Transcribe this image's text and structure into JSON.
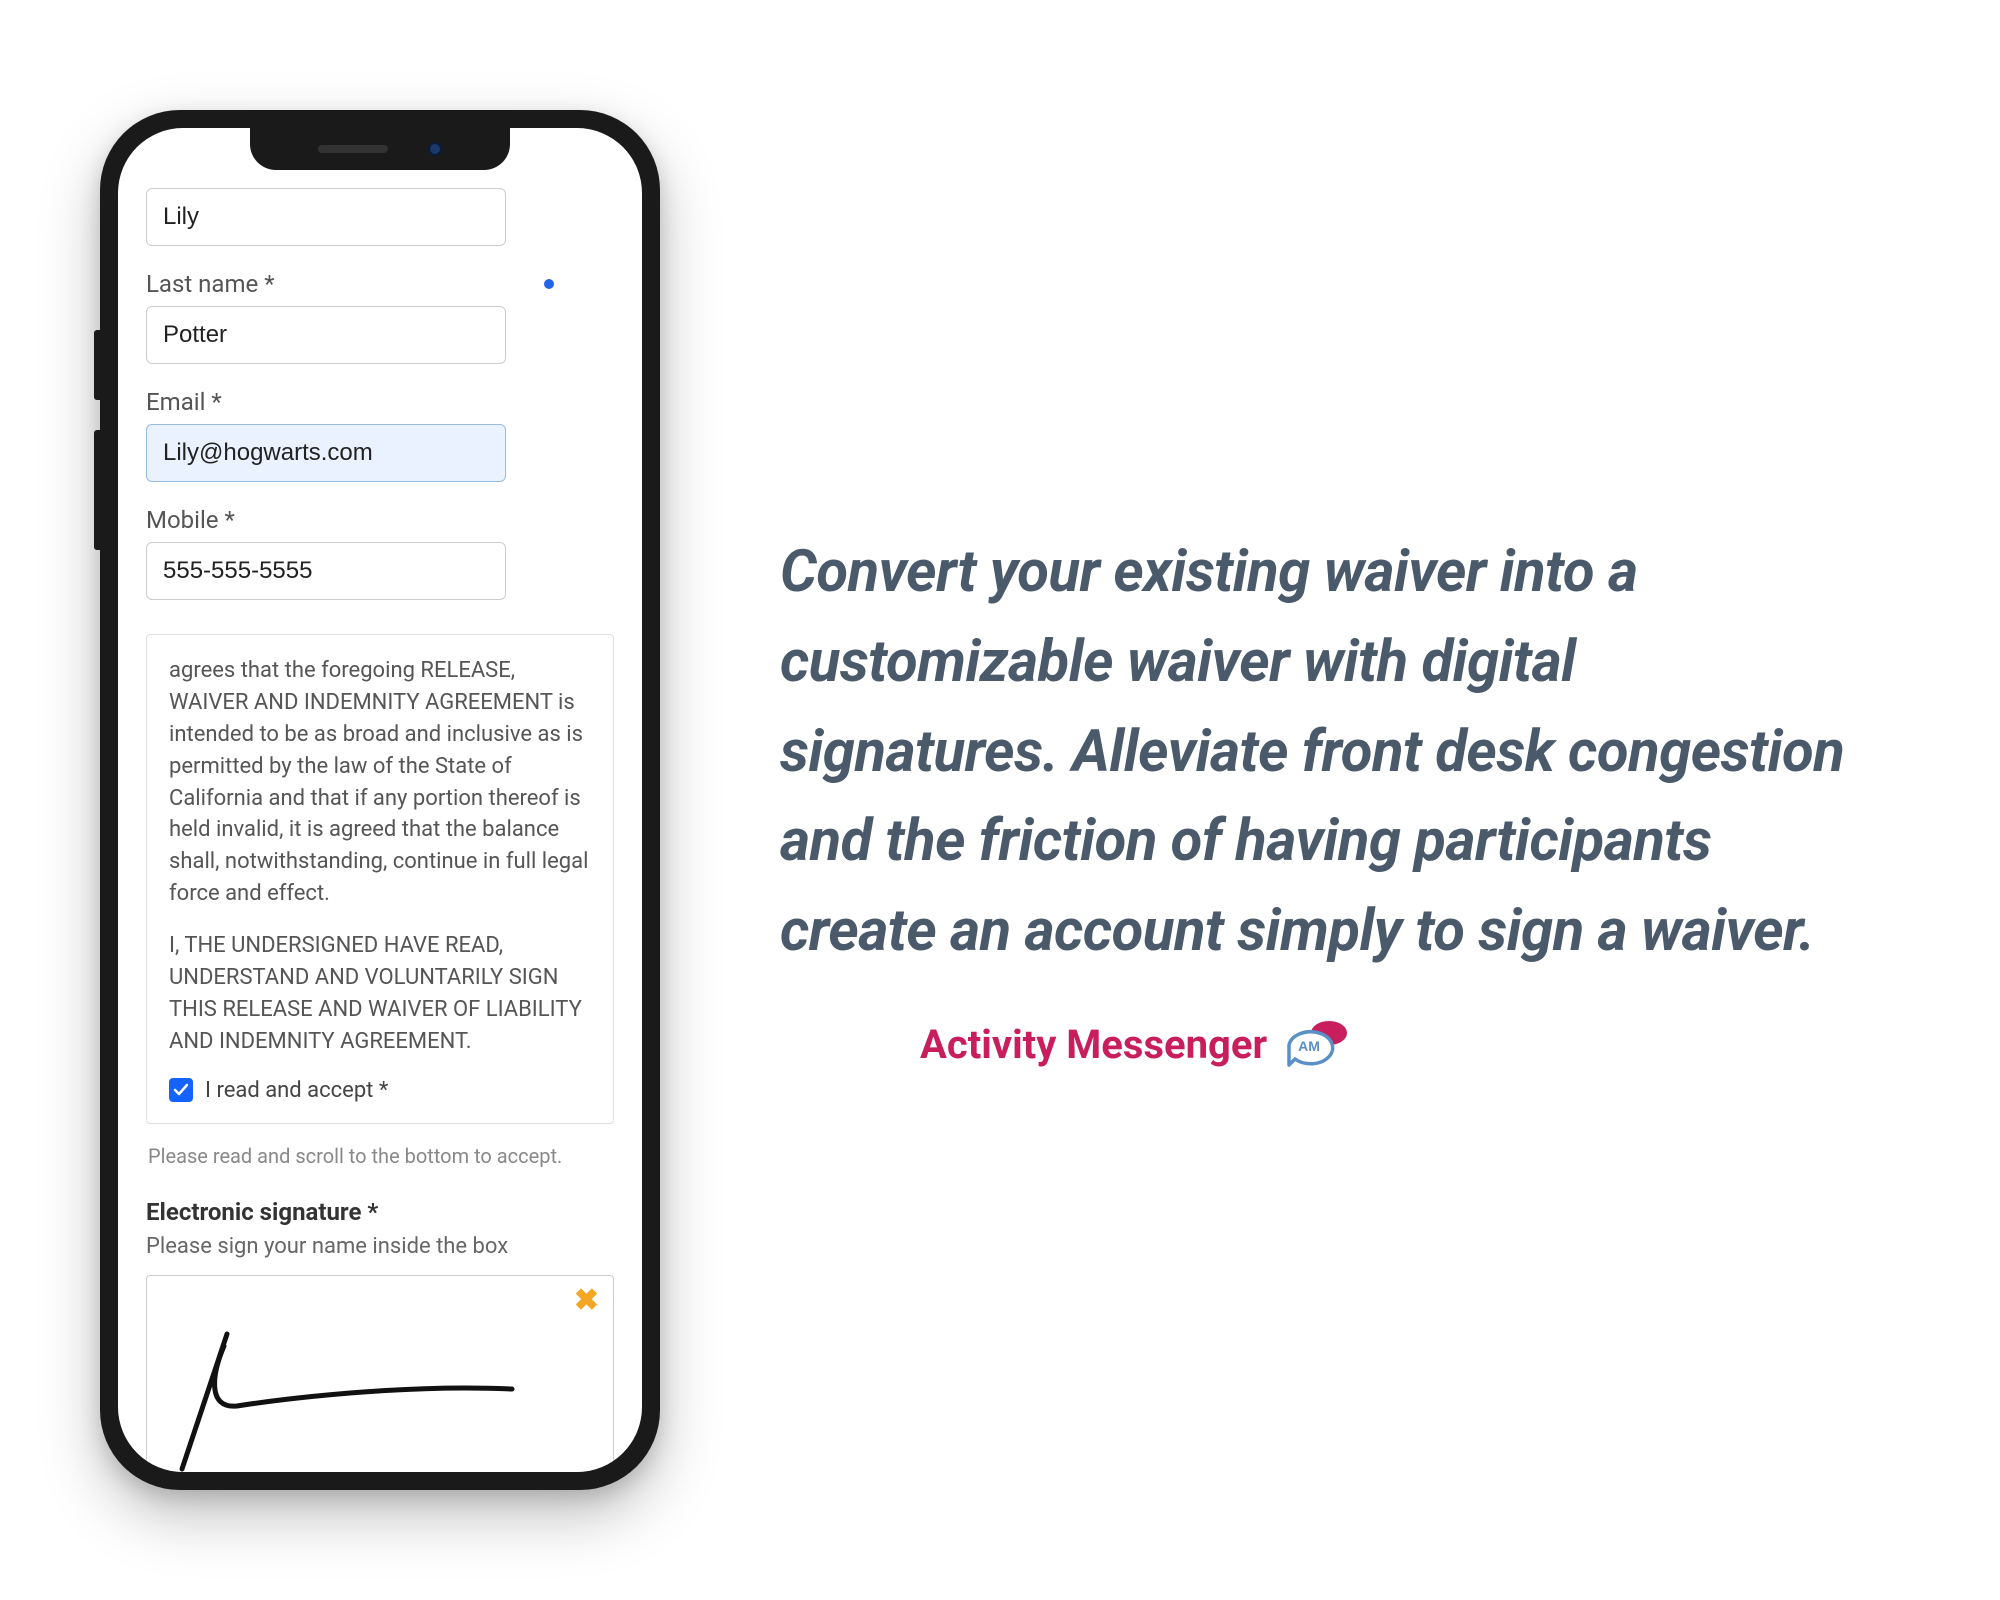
{
  "form": {
    "first_name_value": "Lily",
    "last_name_label": "Last name *",
    "last_name_value": "Potter",
    "email_label": "Email *",
    "email_value": "Lily@hogwarts.com",
    "mobile_label": "Mobile *",
    "mobile_value": "555-555-5555",
    "waiver_para1": "agrees that the foregoing RELEASE, WAIVER AND INDEMNITY AGREEMENT is intended to be as broad and inclusive as is permitted by the law of the State of California and that if any portion thereof is held invalid, it is agreed that the balance shall, notwithstanding, continue in full legal force and effect.",
    "waiver_para2": "I, THE UNDERSIGNED HAVE READ, UNDERSTAND AND VOLUNTARILY SIGN THIS RELEASE AND WAIVER OF LIABILITY AND INDEMNITY AGREEMENT.",
    "accept_label": "I read and accept *",
    "accept_checked": true,
    "scroll_hint": "Please read and scroll to the bottom to accept.",
    "signature_title": "Electronic signature *",
    "signature_hint": "Please sign your name inside the box",
    "signature_clear": "✖"
  },
  "marketing": {
    "headline": "Convert your existing waiver into a customizable waiver with digital signatures. Alleviate front desk congestion and the friction of having participants create an account simply to sign a waiver.",
    "brand_name": "Activity Messenger",
    "brand_badge": "AM"
  },
  "colors": {
    "brand_pink": "#c91e5e",
    "brand_blue": "#5a8fc7",
    "text_slate": "#4a5a6a",
    "checkbox_blue": "#1463ff",
    "clear_orange": "#f5a623"
  }
}
